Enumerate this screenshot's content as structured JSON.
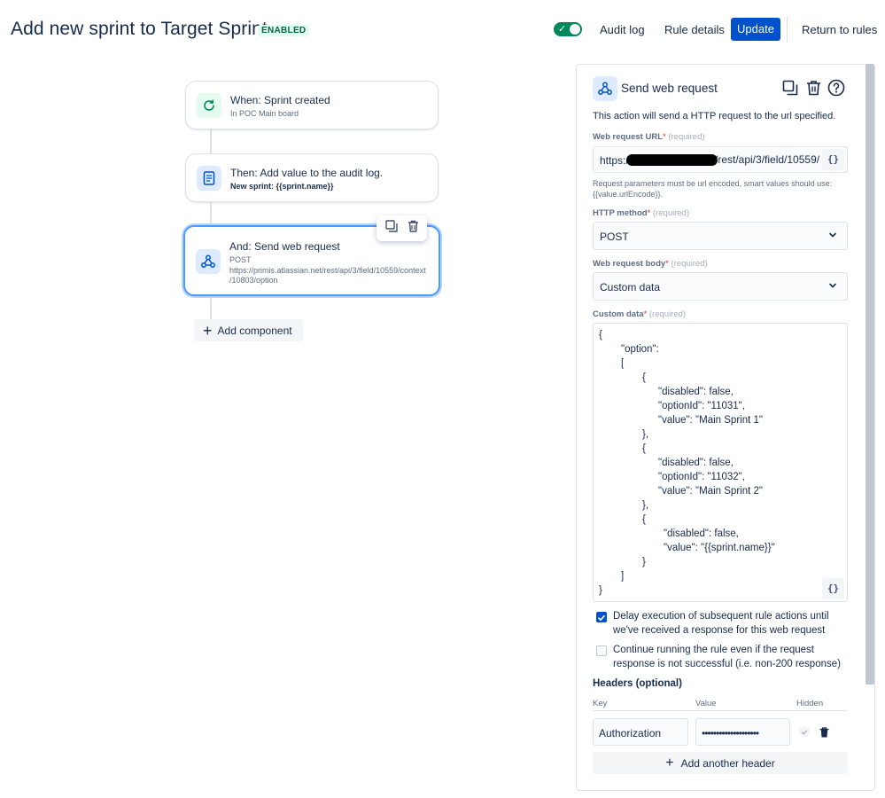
{
  "header": {
    "title": "Add new sprint to Target Sprint",
    "status_badge": "ENABLED",
    "audit_log": "Audit log",
    "rule_details": "Rule details",
    "update": "Update",
    "return_to_rules": "Return to rules"
  },
  "flow": {
    "trigger": {
      "title": "When: Sprint created",
      "subtitle": "In POC Main board"
    },
    "action_1": {
      "title": "Then: Add value to the audit log.",
      "subtitle": "New sprint: {{sprint.name}}"
    },
    "action_2": {
      "title": "And: Send web request",
      "method": "POST",
      "url_line1": "https://primis.atlassian.net/rest/api/3/field/10559/context",
      "url_line2": "/10803/option"
    },
    "add_component": "Add component"
  },
  "panel": {
    "title": "Send web request",
    "description": "This action will send a HTTP request to the url specified.",
    "url_label": "Web request URL",
    "required_marker": "*",
    "required_text": "(required)",
    "url_prefix": "https:/",
    "url_suffix": "/rest/api/3/field/10559/",
    "smart_value_button": "{}",
    "url_help": "Request parameters must be url encoded, smart values should use: {{value.urlEncode}}.",
    "method_label": "HTTP method",
    "method_value": "POST",
    "body_label": "Web request body",
    "body_value": "Custom data",
    "custom_data_label": "Custom data",
    "custom_data_lines": [
      "{",
      "\"option\":",
      "[",
      "{",
      "\"disabled\": false,",
      "\"optionId\": \"11031\",",
      "\"value\": \"Main Sprint 1\"",
      "},",
      "{",
      "\"disabled\": false,",
      "\"optionId\": \"11032\",",
      "\"value\": \"Main Sprint 2\"",
      "},",
      "{",
      "\"disabled\": false,",
      "\"value\": \"{{sprint.name}}\"",
      "}",
      "]",
      "}"
    ],
    "delay_checkbox": {
      "checked": true,
      "label": "Delay execution of subsequent rule actions until we've received a response for this web request"
    },
    "continue_checkbox": {
      "checked": false,
      "label": "Continue running the rule even if the request response is not successful (i.e. non-200 response)"
    },
    "headers_label": "Headers (optional)",
    "col_key": "Key",
    "col_value": "Value",
    "col_hidden": "Hidden",
    "header_row": {
      "key": "Authorization",
      "value": "••••••••••••••••••••"
    },
    "add_header": "Add another header"
  },
  "colors": {
    "primary": "#0052cc",
    "success": "#00875a",
    "badge_bg": "#e3fcef",
    "focus_ring": "#4c9aff"
  }
}
